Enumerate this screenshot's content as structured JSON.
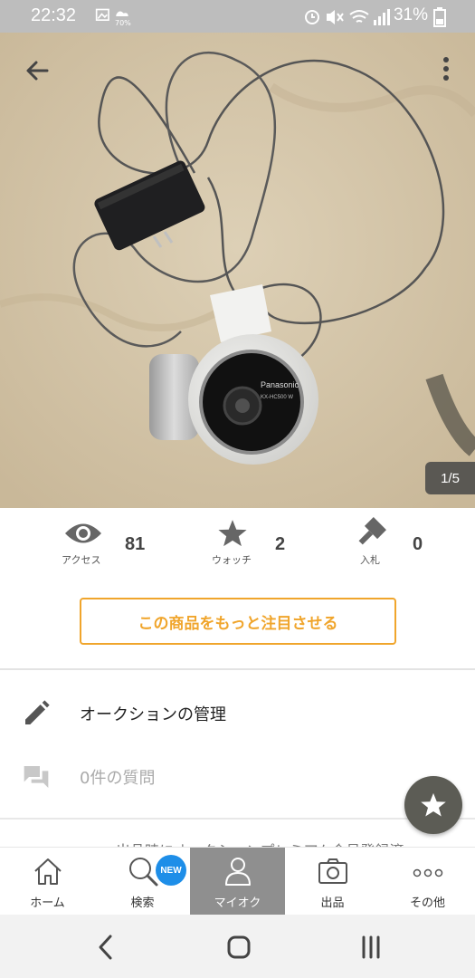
{
  "status_bar": {
    "time": "22:32",
    "battery_percent": "31%",
    "cloud_badge": "70%"
  },
  "photo": {
    "page_indicator": "1/5",
    "camera_brand": "Panasonic",
    "camera_model": "KX-HC500 W"
  },
  "stats": {
    "access": {
      "label": "アクセス",
      "value": "81",
      "icon": "eye-icon"
    },
    "watch": {
      "label": "ウォッチ",
      "value": "2",
      "icon": "star-icon"
    },
    "bids": {
      "label": "入札",
      "value": "0",
      "icon": "gavel-icon"
    }
  },
  "promote_button": {
    "label": "この商品をもっと注目させる"
  },
  "menu": {
    "manage": {
      "label": "オークションの管理",
      "icon": "pencil-icon"
    },
    "questions": {
      "label": "0件の質問",
      "icon": "chat-icon"
    }
  },
  "cut_text": "出品時にオークションプレミアム会員登録済",
  "bottom_nav": {
    "items": [
      {
        "label": "ホーム",
        "icon": "home-icon"
      },
      {
        "label": "検索",
        "icon": "search-icon",
        "badge": "NEW"
      },
      {
        "label": "マイオク",
        "icon": "person-icon",
        "active": true
      },
      {
        "label": "出品",
        "icon": "camera-icon"
      },
      {
        "label": "その他",
        "icon": "more-dots-icon"
      }
    ]
  },
  "colors": {
    "accent": "#f0a52c",
    "new_badge": "#1e8ee8",
    "active_tab": "#8f8f8f",
    "fab": "#5c5c55"
  }
}
